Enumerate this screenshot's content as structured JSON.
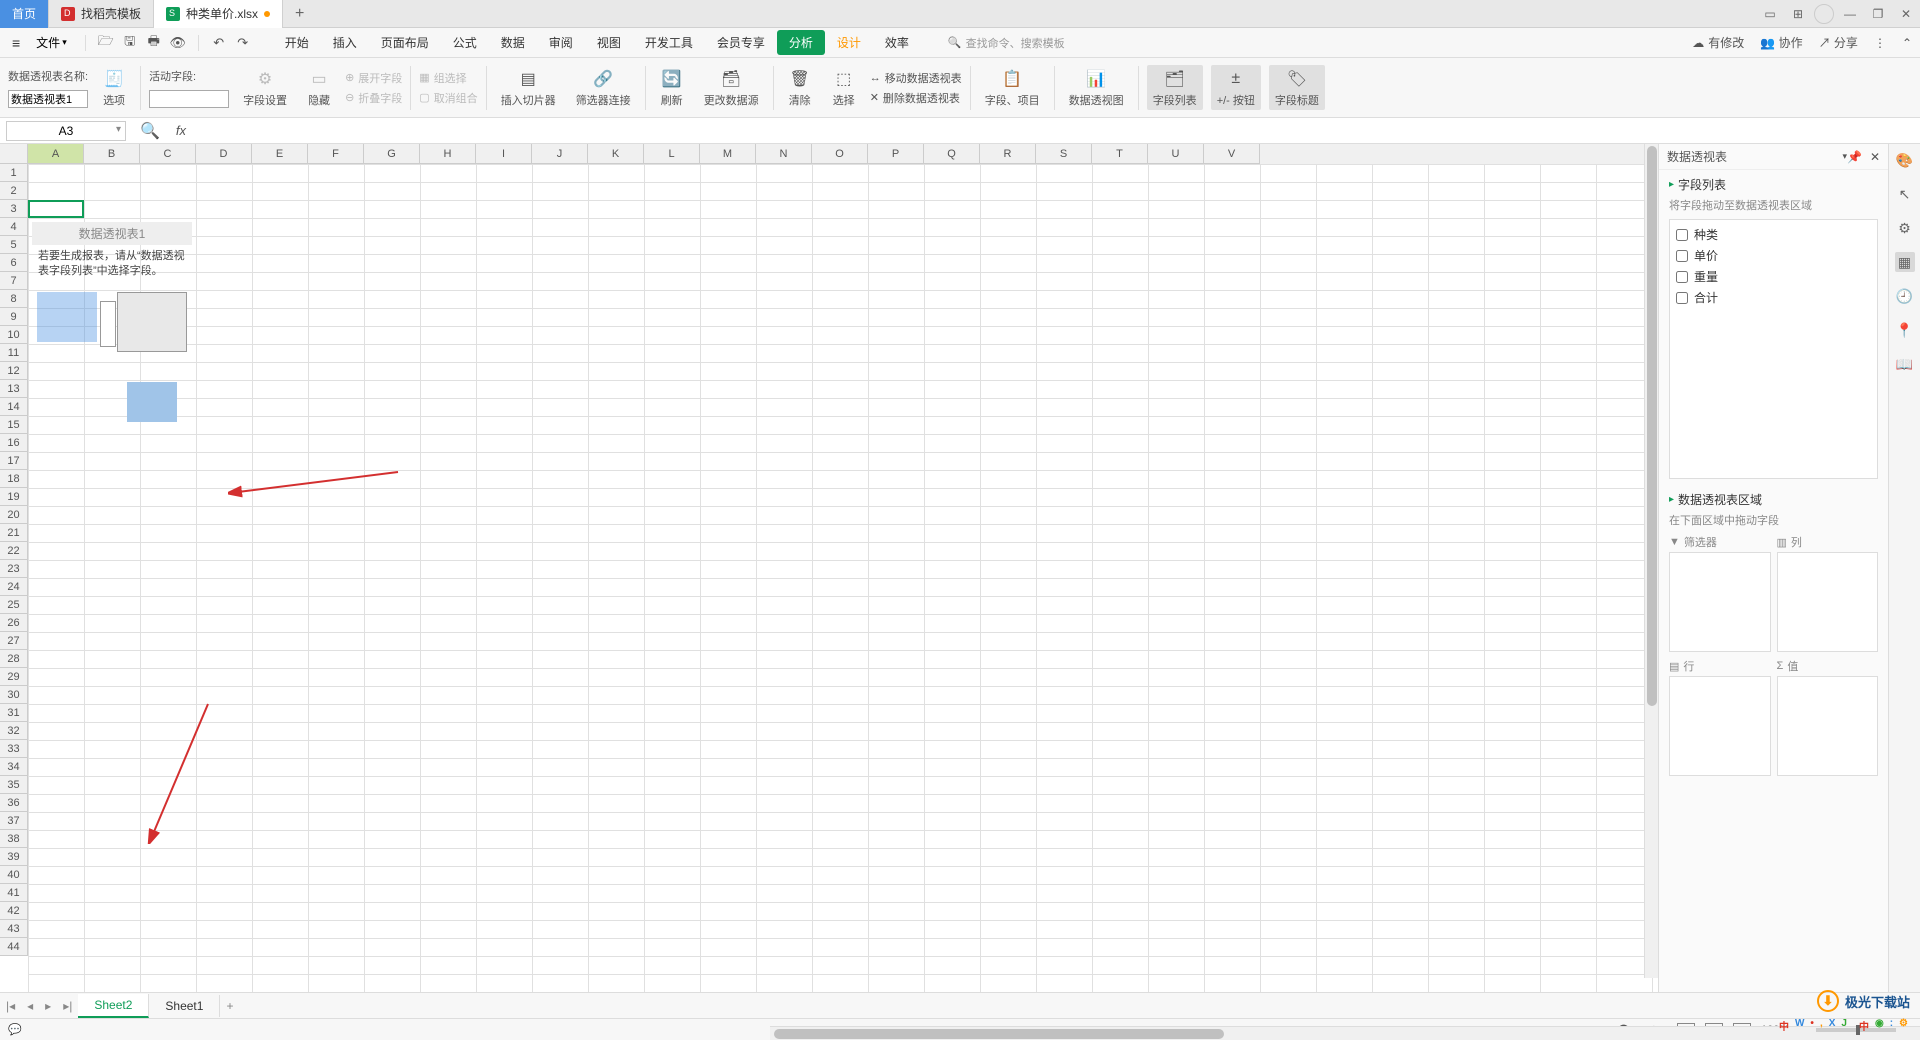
{
  "title_tabs": {
    "home": "首页",
    "template": "找稻壳模板",
    "file": "种类单价.xlsx"
  },
  "window_controls": {
    "minimize": "—",
    "maximize": "❐",
    "close": "✕"
  },
  "menubar": {
    "file_menu": "文件",
    "tabs": [
      "开始",
      "插入",
      "页面布局",
      "公式",
      "数据",
      "审阅",
      "视图",
      "开发工具",
      "会员专享",
      "分析",
      "设计",
      "效率"
    ],
    "active_tab": "分析",
    "search_placeholder": "查找命令、搜索模板",
    "cloud_status": "有修改",
    "cooperate": "协作",
    "share": "分享"
  },
  "toolbar": {
    "pivot_name_label": "数据透视表名称:",
    "pivot_name_value": "数据透视表1",
    "active_field_label": "活动字段:",
    "options": "选项",
    "field_settings": "字段设置",
    "hide": "隐藏",
    "expand_field": "展开字段",
    "collapse_field": "折叠字段",
    "group_select": "组选择",
    "ungroup": "取消组合",
    "insert_slicer": "插入切片器",
    "filter_connect": "筛选器连接",
    "refresh": "刷新",
    "change_source": "更改数据源",
    "clear": "清除",
    "select": "选择",
    "move_pivot": "移动数据透视表",
    "delete_pivot": "删除数据透视表",
    "fields": "字段、项目",
    "pivot_chart": "数据透视图",
    "field_list": "字段列表",
    "pm_buttons": "+/- 按钮",
    "field_headers": "字段标题"
  },
  "namebox": "A3",
  "fx": "fx",
  "columns": [
    "A",
    "B",
    "C",
    "D",
    "E",
    "F",
    "G",
    "H",
    "I",
    "J",
    "K",
    "L",
    "M",
    "N",
    "O",
    "P",
    "Q",
    "R",
    "S",
    "T",
    "U",
    "V"
  ],
  "pivot_placeholder": {
    "title": "数据透视表1",
    "hint": "若要生成报表，请从“数据透视表字段列表”中选择字段。"
  },
  "right_panel": {
    "title": "数据透视表",
    "section_fields": "字段列表",
    "drag_hint": "将字段拖动至数据透视表区域",
    "fields": [
      "种类",
      "单价",
      "重量",
      "合计"
    ],
    "section_areas": "数据透视表区域",
    "area_hint": "在下面区域中拖动字段",
    "area_filter": "筛选器",
    "area_column": "列",
    "area_row": "行",
    "area_value": "值"
  },
  "sheets": {
    "active": "Sheet2",
    "other": "Sheet1"
  },
  "statusbar": {
    "zoom": "100%"
  },
  "watermark": "极光下载站"
}
